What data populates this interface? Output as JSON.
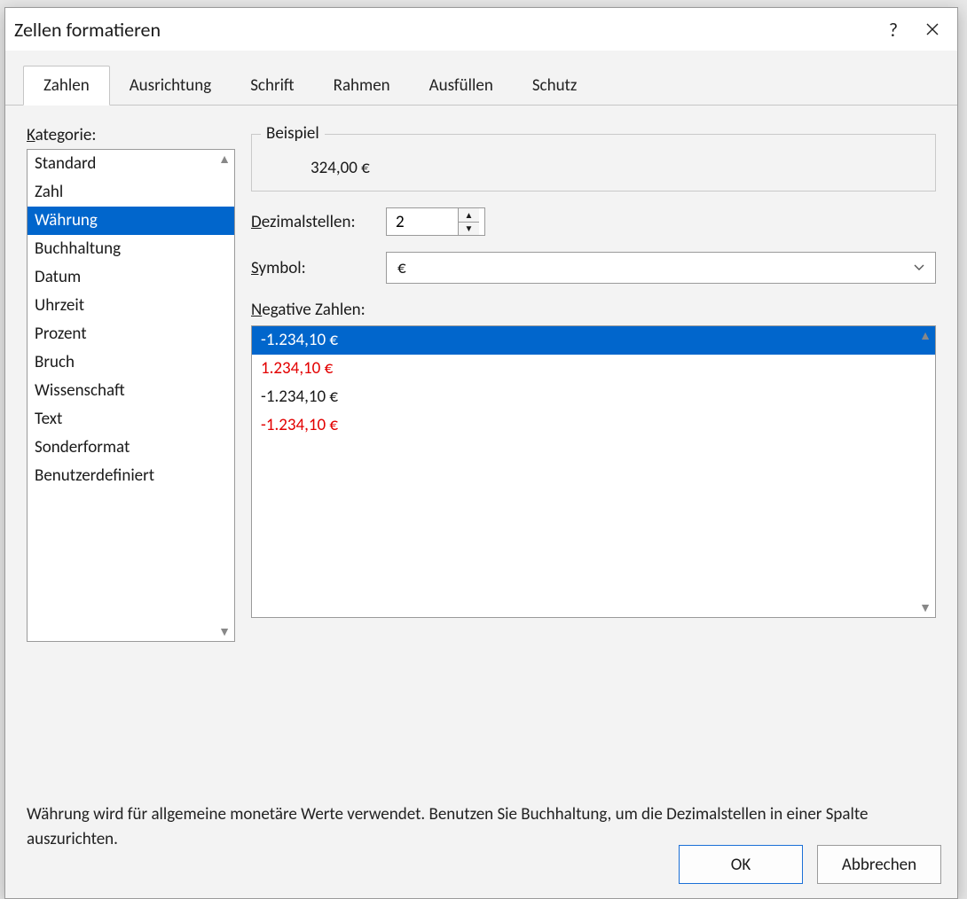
{
  "dialog": {
    "title": "Zellen formatieren"
  },
  "tabs": [
    {
      "label": "Zahlen"
    },
    {
      "label": "Ausrichtung"
    },
    {
      "label": "Schrift"
    },
    {
      "label": "Rahmen"
    },
    {
      "label": "Ausfüllen"
    },
    {
      "label": "Schutz"
    }
  ],
  "category": {
    "label": "Kategorie:",
    "items": [
      "Standard",
      "Zahl",
      "Währung",
      "Buchhaltung",
      "Datum",
      "Uhrzeit",
      "Prozent",
      "Bruch",
      "Wissenschaft",
      "Text",
      "Sonderformat",
      "Benutzerdefiniert"
    ],
    "selected_index": 2
  },
  "sample": {
    "label": "Beispiel",
    "value": "324,00 €"
  },
  "decimals": {
    "label": "Dezimalstellen:",
    "value": "2"
  },
  "symbol": {
    "label": "Symbol:",
    "value": "€"
  },
  "negative": {
    "label": "Negative Zahlen:",
    "items": [
      {
        "text": "-1.234,10 €",
        "red": false
      },
      {
        "text": "1.234,10 €",
        "red": true
      },
      {
        "text": "-1.234,10 €",
        "red": false
      },
      {
        "text": "-1.234,10 €",
        "red": true
      }
    ],
    "selected_index": 0
  },
  "description": "Währung wird für allgemeine monetäre Werte verwendet. Benutzen Sie Buchhaltung, um die Dezimalstellen in einer Spalte auszurichten.",
  "buttons": {
    "ok": "OK",
    "cancel": "Abbrechen"
  }
}
